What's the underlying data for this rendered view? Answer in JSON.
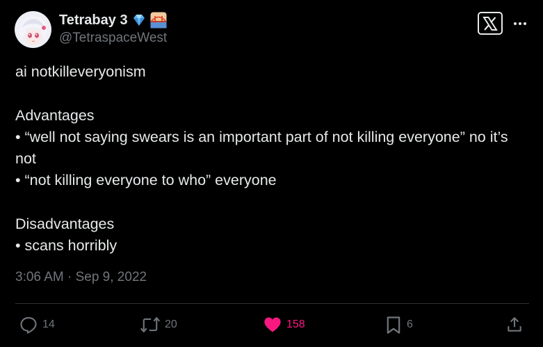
{
  "tweet": {
    "author": {
      "display_name": "Tetrabay 3",
      "handle": "@TetraspaceWest",
      "badges": [
        "gem-icon",
        "bridge-icon"
      ]
    },
    "paragraphs": [
      "ai notkilleveryonism",
      "Advantages\n• “well not saying swears is an important part of not killing everyone” no it’s not\n• “not killing everyone to who” everyone",
      "Disadvantages\n• scans horribly"
    ],
    "timestamp": "3:06 AM · Sep 9, 2022"
  },
  "header_icons": [
    "x-logo-icon",
    "more-options-icon"
  ],
  "actions": {
    "reply": {
      "icon": "reply-icon",
      "count": "14"
    },
    "retweet": {
      "icon": "retweet-icon",
      "count": "20"
    },
    "like": {
      "icon": "heart-icon",
      "count": "158",
      "active": true,
      "color": "#f91880"
    },
    "bookmark": {
      "icon": "bookmark-icon",
      "count": "6"
    },
    "share": {
      "icon": "share-icon"
    }
  },
  "colors": {
    "background": "#000000",
    "text": "#e7e9ea",
    "secondary_text": "#71767b",
    "divider": "#2f3336",
    "like": "#f91880"
  }
}
